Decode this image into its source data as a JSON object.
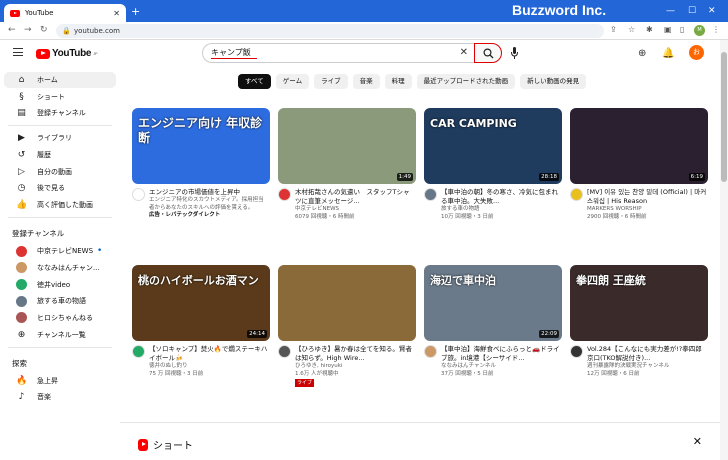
{
  "browser": {
    "tab_title": "YouTube",
    "url": "youtube.com",
    "brand": "Buzzword Inc."
  },
  "header": {
    "logo": "YouTube",
    "logo_sup": "JP",
    "search_value": "キャンプ飯",
    "user_initial": "お"
  },
  "sidebar": {
    "main": [
      {
        "label": "ホーム",
        "icon": "home-icon"
      },
      {
        "label": "ショート",
        "icon": "shorts-icon"
      },
      {
        "label": "登録チャンネル",
        "icon": "subscriptions-icon"
      }
    ],
    "library": [
      {
        "label": "ライブラリ",
        "icon": "library-icon"
      },
      {
        "label": "履歴",
        "icon": "history-icon"
      },
      {
        "label": "自分の動画",
        "icon": "your-videos-icon"
      },
      {
        "label": "後で見る",
        "icon": "watch-later-icon"
      },
      {
        "label": "高く評価した動画",
        "icon": "liked-icon"
      }
    ],
    "subs_heading": "登録チャンネル",
    "subs": [
      {
        "label": "中京テレビNEWS",
        "color": "#d33"
      },
      {
        "label": "ななみはんチャン...",
        "color": "#c96"
      },
      {
        "label": "徳井video",
        "color": "#2a6"
      },
      {
        "label": "旅する車の物語",
        "color": "#678"
      },
      {
        "label": "ヒロシちゃんねる",
        "color": "#a55"
      },
      {
        "label": "チャンネル一覧",
        "color": ""
      }
    ],
    "explore_heading": "探索",
    "explore": [
      {
        "label": "急上昇",
        "icon": "trending-icon"
      },
      {
        "label": "音楽",
        "icon": "music-icon"
      }
    ]
  },
  "chips": [
    "すべて",
    "ゲーム",
    "ライブ",
    "音楽",
    "料理",
    "最近アップロードされた動画",
    "新しい動画の発見"
  ],
  "videos": [
    {
      "title": "エンジニアの市場価値を上昇中",
      "line2": "エンジニア特化のスカウトメディア。採用担当者からあなたのスキルへの評価を貰える。",
      "channel": "広告・レバテックダイレクト",
      "stats": "",
      "duration": "",
      "thumb_text": "エンジニア向け 年収診断",
      "bg": "#2d6cdf",
      "av": "#ffffff"
    },
    {
      "title": "木村拓哉さんの気遣い　スタッフTシャツに直筆メッセージ...",
      "line2": "",
      "channel": "中京テレビNEWS",
      "stats": "6079 回視聴・6 時間前",
      "duration": "1:49",
      "thumb_text": "",
      "bg": "#8a9a7a",
      "av": "#d33"
    },
    {
      "title": "【車中泊の朝】冬の寒さ、冷気に包まれる車中泊。大失敗...",
      "line2": "",
      "channel": "旅する車の物語",
      "stats": "10万 回視聴・3 日前",
      "duration": "28:18",
      "thumb_text": "CAR CAMPING",
      "bg": "#1f3b5e",
      "av": "#678"
    },
    {
      "title": "[MV] 이유 있는 찬양 밑데 (Official) | 마커스워십 | His Reason",
      "line2": "",
      "channel": "MARKERS WORSHIP",
      "stats": "2900 回視聴・6 時間前",
      "duration": "6:19",
      "thumb_text": "",
      "bg": "#2a2030",
      "av": "#e8c020"
    },
    {
      "title": "【ソロキャンプ】焚火🔥で燗ステーキハイボール🍻",
      "line2": "",
      "channel": "徳井のぬし釣り",
      "stats": "75 万 回視聴・3 日前",
      "duration": "24:14",
      "thumb_text": "桃のハイボールお酒マン",
      "bg": "#5a3a1a",
      "av": "#2a6"
    },
    {
      "title": "【ひろゆき】暑か春は全てを知る。賢者は知らず。High Wire...",
      "line2": "",
      "channel": "ひろゆき, hiroyuki",
      "stats": "1.6万 人が視聴中",
      "duration": "",
      "thumb_text": "",
      "bg": "#8b6a3a",
      "av": "#555",
      "live": "ライブ"
    },
    {
      "title": "【車中泊】海鮮食べにふらっと🚗ドライブ旅。in境港【シーサイド...",
      "line2": "",
      "channel": "ななみはんチャンネル",
      "stats": "37万 回視聴・5 日前",
      "duration": "22:09",
      "thumb_text": "海辺で車中泊",
      "bg": "#6a7a8a",
      "av": "#c96"
    },
    {
      "title": "Vol.284【こんなにも実力差が!?拳四郎 京口(TKO解説付き)...",
      "line2": "",
      "channel": "週刊暴露隊的決戦実況チャンネル",
      "stats": "12万 回視聴・6 日前",
      "duration": "",
      "thumb_text": "拳四朗 王座統",
      "bg": "#3a2a2a",
      "av": "#333"
    }
  ],
  "shorts_label": "ショート"
}
